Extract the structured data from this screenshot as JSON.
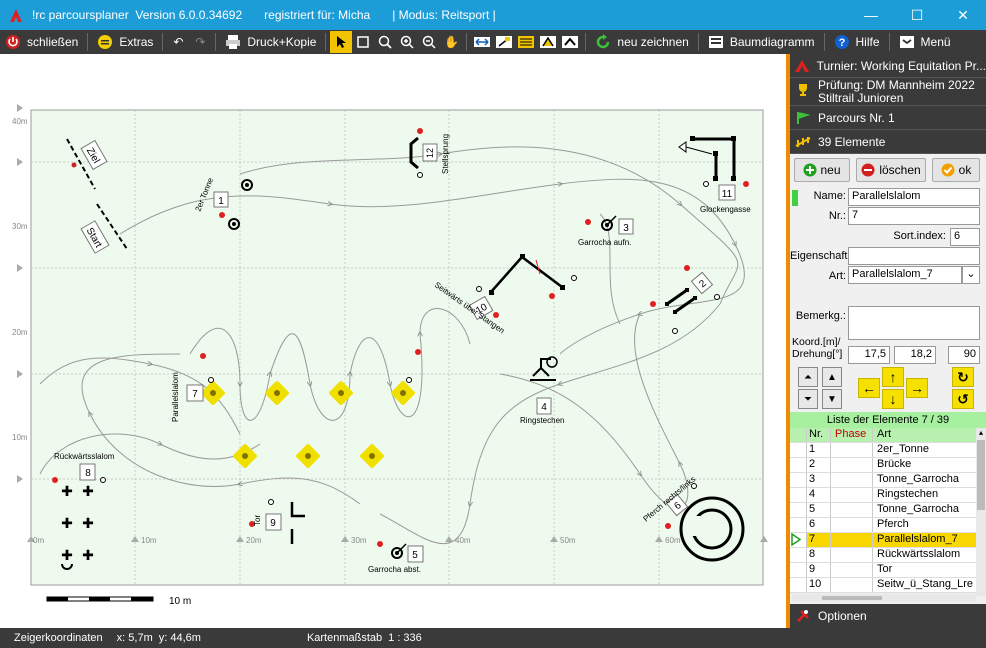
{
  "window": {
    "title_app": "!rc parcoursplaner",
    "title_version": "Version 6.0.0.34692",
    "title_registered": "registriert für: Micha",
    "title_mode": "| Modus: Reitsport |"
  },
  "toolbar": {
    "close_label": "schließen",
    "extras_label": "Extras",
    "print_label": "Druck+Kopie",
    "redraw_label": "neu zeichnen",
    "tree_label": "Baumdiagramm",
    "help_label": "Hilfe",
    "menu_label": "Menü"
  },
  "arena": {
    "y_labels": [
      "40m",
      "30m",
      "20m",
      "10m"
    ],
    "x_labels": [
      "0m",
      "10m",
      "20m",
      "30m",
      "40m",
      "50m",
      "60m"
    ],
    "scale_label": "10 m",
    "obstacles": [
      {
        "num": "1",
        "label": "2er Tonne"
      },
      {
        "num": "3",
        "label": "Garrocha aufn."
      },
      {
        "num": "4",
        "label": "Ringstechen"
      },
      {
        "num": "5",
        "label": "Garrocha abst."
      },
      {
        "num": "6",
        "label": "Pferch rechts/links"
      },
      {
        "num": "7",
        "label": "Parallelslalom"
      },
      {
        "num": "8",
        "label": "Rückwärtsslalom"
      },
      {
        "num": "9",
        "label": "Tor"
      },
      {
        "num": "10",
        "label": "Seitwärts über Stangen"
      },
      {
        "num": "11",
        "label": "Glockengasse"
      },
      {
        "num": "12",
        "label": "Stellsprung"
      },
      {
        "num": "2",
        "label": ""
      }
    ],
    "start_label": "Start",
    "finish_label": "Ziel"
  },
  "panel": {
    "tournament": "Turnier: Working Equitation Pr...",
    "exam_line1": "Prüfung: DM Mannheim 2022",
    "exam_line2": "Stiltrail Junioren",
    "parcours": "Parcours  Nr. 1",
    "elements": "39 Elemente",
    "btn_new": "neu",
    "btn_delete": "löschen",
    "btn_ok": "ok",
    "name_label": "Name:",
    "name_value": "Parallelslalom",
    "nr_label": "Nr.:",
    "nr_value": "7",
    "sortindex_label": "Sort.index:",
    "sortindex_value": "6",
    "property_label": "Eigenschaft:",
    "property_value": "",
    "type_label": "Art:",
    "type_value": "Parallelslalom_7",
    "remark_label": "Bemerkg.:",
    "remark_value": "",
    "coord_label1": "Koord.[m]/",
    "coord_label2": "Drehung[°]",
    "coord_x": "17,5",
    "coord_y": "18,2",
    "rotation": "90",
    "list_title": "Liste der Elemente      7 / 39",
    "list_headers": [
      "Nr.",
      "Phase",
      "Art"
    ],
    "list_rows": [
      {
        "nr": "1",
        "phase": "",
        "art": "2er_Tonne"
      },
      {
        "nr": "2",
        "phase": "",
        "art": "Brücke"
      },
      {
        "nr": "3",
        "phase": "",
        "art": "Tonne_Garrocha"
      },
      {
        "nr": "4",
        "phase": "",
        "art": "Ringstechen"
      },
      {
        "nr": "5",
        "phase": "",
        "art": "Tonne_Garrocha"
      },
      {
        "nr": "6",
        "phase": "",
        "art": "Pferch"
      },
      {
        "nr": "7",
        "phase": "",
        "art": "Parallelslalom_7"
      },
      {
        "nr": "8",
        "phase": "",
        "art": "Rückwärtsslalom"
      },
      {
        "nr": "9",
        "phase": "",
        "art": "Tor"
      },
      {
        "nr": "10",
        "phase": "",
        "art": "Seitw_ü_Stang_Lre"
      }
    ],
    "selected_index": 6,
    "options_label": "Optionen"
  },
  "status": {
    "pointer_label": "Zeigerkoordinaten",
    "pointer_x": "x: 5,7m",
    "pointer_y": "y: 44,6m",
    "scale_label": "Kartenmaßstab",
    "scale_value": "1 : 336"
  },
  "colors": {
    "titlebar": "#1d9dd8",
    "toolbar": "#3a3a3a",
    "accent_orange": "#f08a00",
    "arena_bg": "#eefaee",
    "selected_row": "#f8d800",
    "list_header": "#a6f0a0"
  }
}
